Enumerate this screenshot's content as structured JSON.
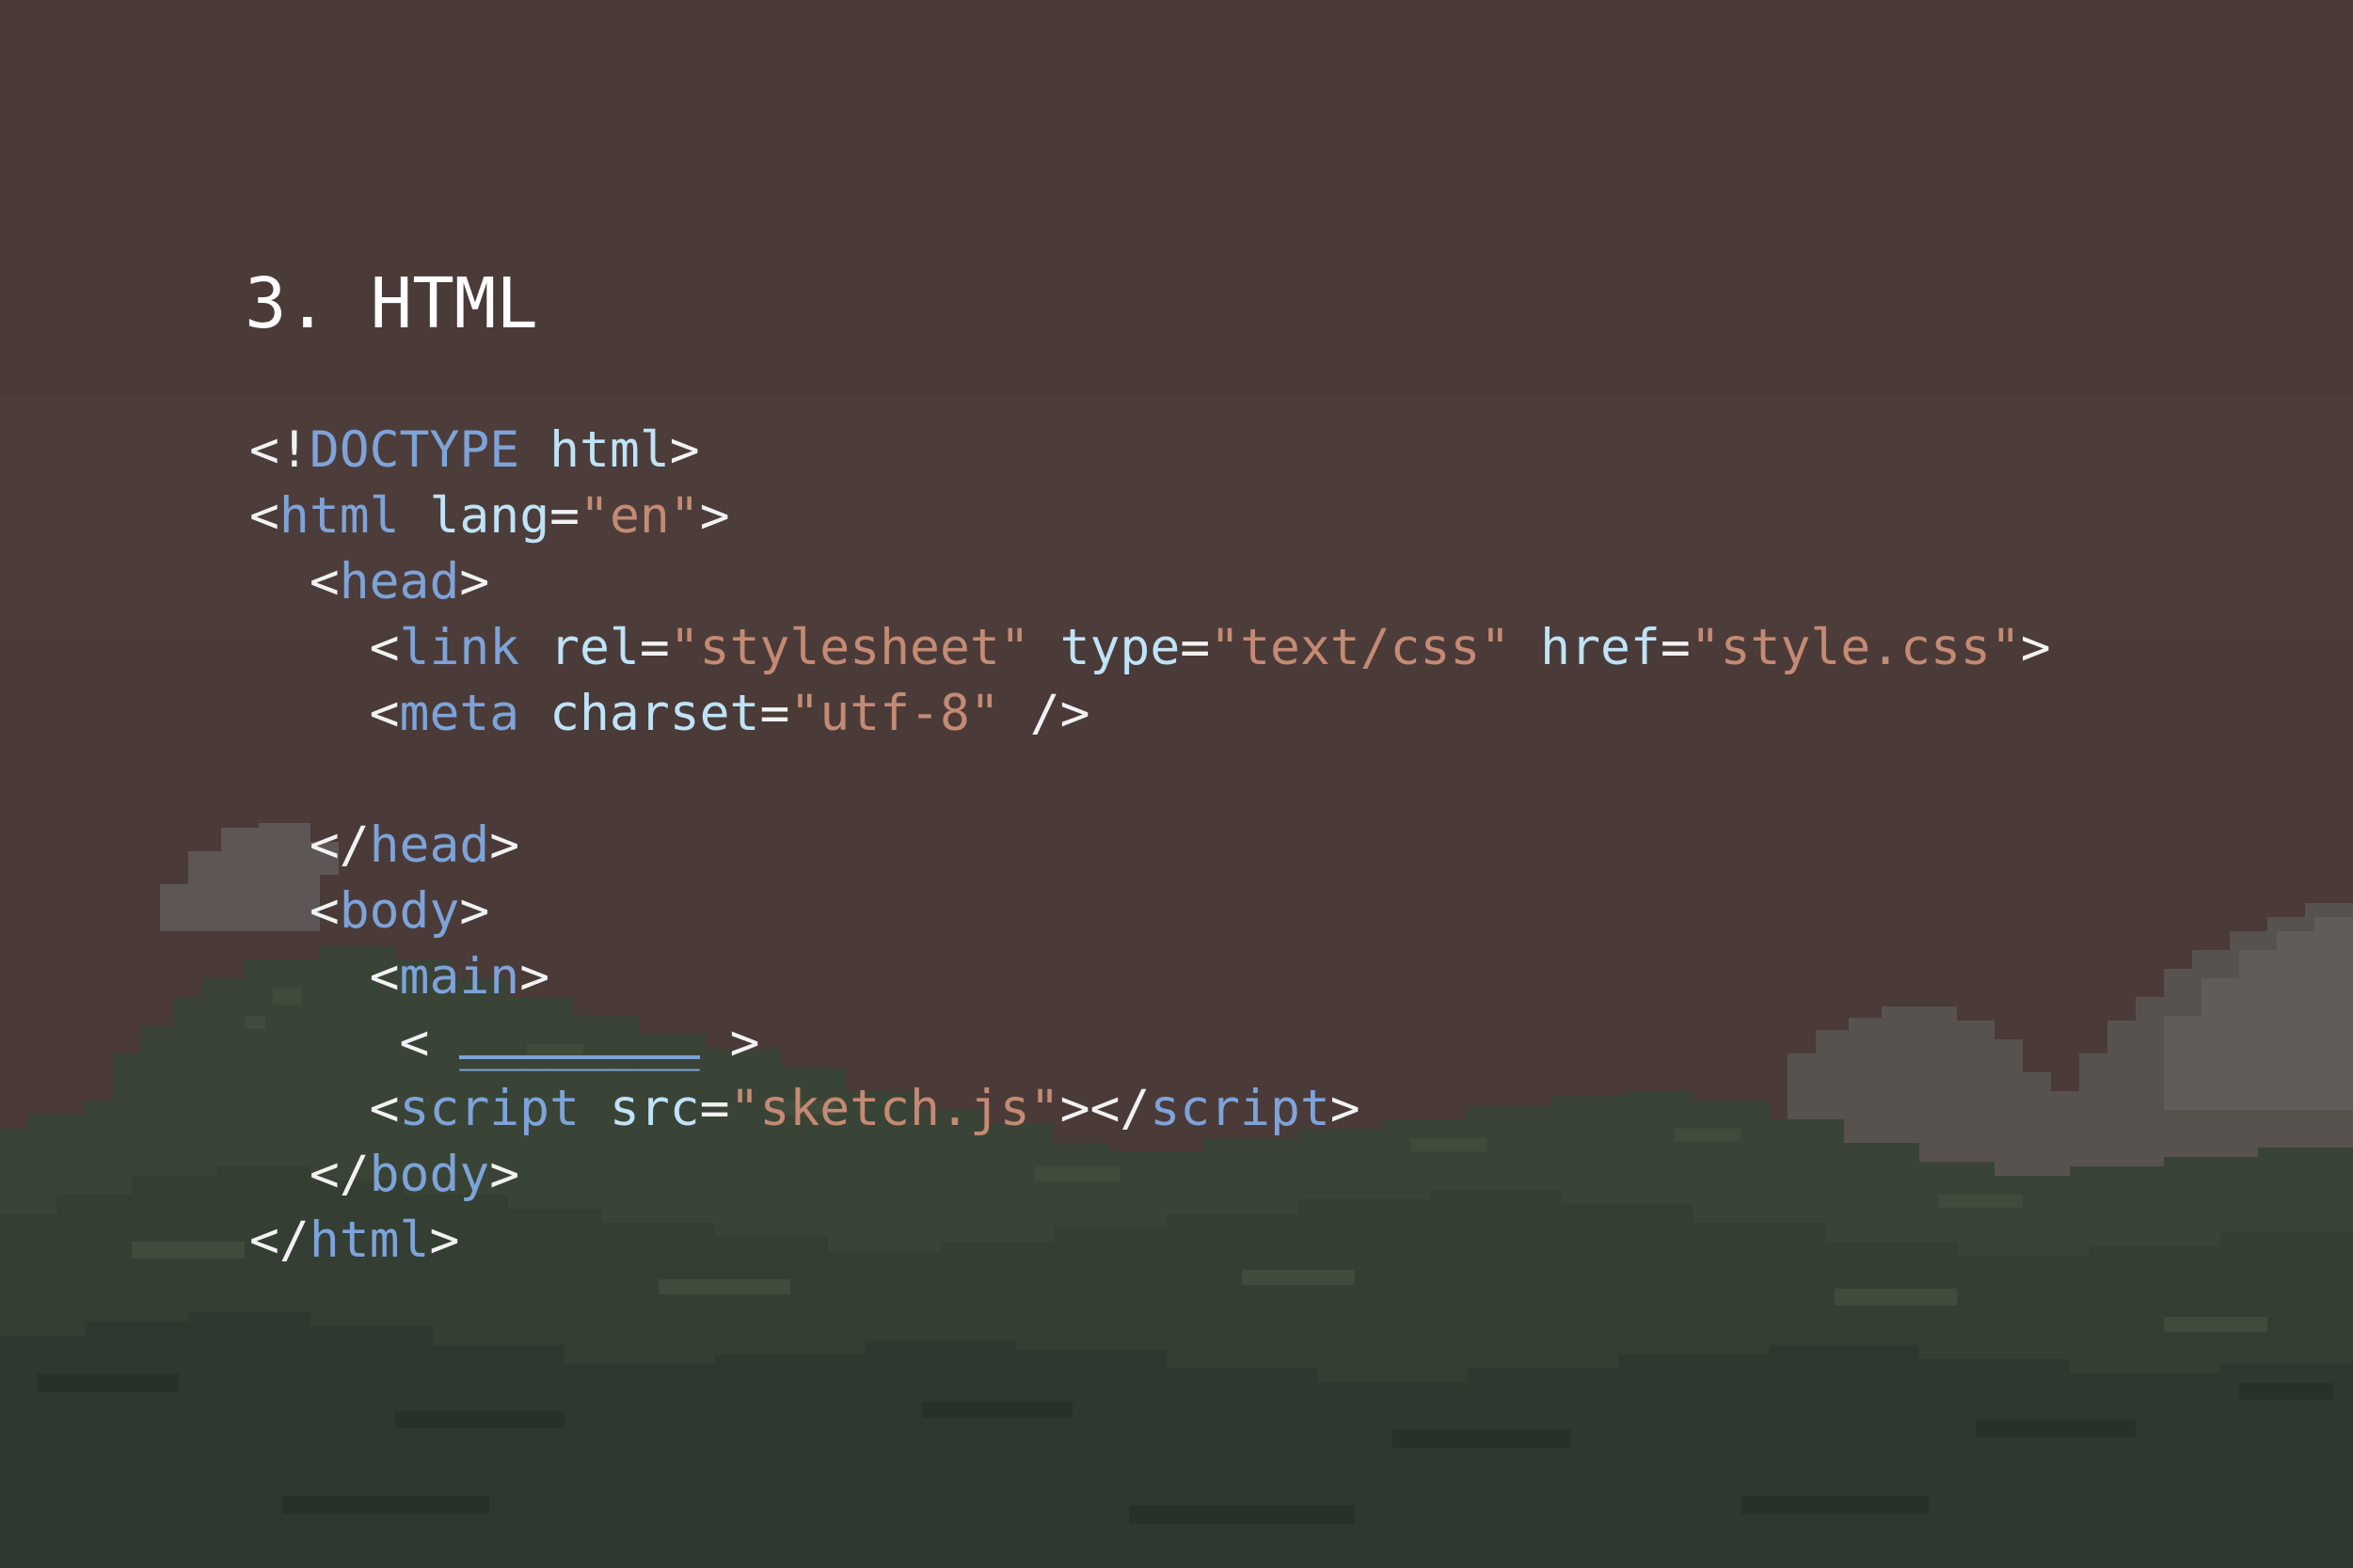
{
  "slide": {
    "title": "3. HTML"
  },
  "colors": {
    "sky": "#4a3b38",
    "hill_dark": "#2e382f",
    "hill_mid": "#3a4436",
    "hill_light": "#414b3c",
    "mountain_grey": "#58524f",
    "mountain_grey_light": "#5f5a58",
    "tag": "#7ea3d9",
    "attribute": "#bfe3f7",
    "string": "#c48a74",
    "punctuation": "#f2f2f2",
    "title": "#ffffff"
  },
  "code": {
    "lines": [
      [
        {
          "t": "<!",
          "k": "punct"
        },
        {
          "t": "DOCTYPE",
          "k": "tag"
        },
        {
          "t": " ",
          "k": "punct"
        },
        {
          "t": "html",
          "k": "attr"
        },
        {
          "t": ">",
          "k": "punct"
        }
      ],
      [
        {
          "t": "<",
          "k": "punct"
        },
        {
          "t": "html",
          "k": "tag"
        },
        {
          "t": " ",
          "k": "punct"
        },
        {
          "t": "lang",
          "k": "attr"
        },
        {
          "t": "=",
          "k": "punct"
        },
        {
          "t": "\"en\"",
          "k": "str"
        },
        {
          "t": ">",
          "k": "punct"
        }
      ],
      [
        {
          "t": "  <",
          "k": "punct"
        },
        {
          "t": "head",
          "k": "tag"
        },
        {
          "t": ">",
          "k": "punct"
        }
      ],
      [
        {
          "t": "    <",
          "k": "punct"
        },
        {
          "t": "link",
          "k": "tag"
        },
        {
          "t": " ",
          "k": "punct"
        },
        {
          "t": "rel",
          "k": "attr"
        },
        {
          "t": "=",
          "k": "punct"
        },
        {
          "t": "\"stylesheet\"",
          "k": "str"
        },
        {
          "t": " ",
          "k": "punct"
        },
        {
          "t": "type",
          "k": "attr"
        },
        {
          "t": "=",
          "k": "punct"
        },
        {
          "t": "\"text/css\"",
          "k": "str"
        },
        {
          "t": " ",
          "k": "punct"
        },
        {
          "t": "href",
          "k": "attr"
        },
        {
          "t": "=",
          "k": "punct"
        },
        {
          "t": "\"style.css\"",
          "k": "str"
        },
        {
          "t": ">",
          "k": "punct"
        }
      ],
      [
        {
          "t": "    <",
          "k": "punct"
        },
        {
          "t": "meta",
          "k": "tag"
        },
        {
          "t": " ",
          "k": "punct"
        },
        {
          "t": "charset",
          "k": "attr"
        },
        {
          "t": "=",
          "k": "punct"
        },
        {
          "t": "\"utf-8\"",
          "k": "str"
        },
        {
          "t": " />",
          "k": "punct"
        }
      ],
      [],
      [
        {
          "t": "  </",
          "k": "punct"
        },
        {
          "t": "head",
          "k": "tag"
        },
        {
          "t": ">",
          "k": "punct"
        }
      ],
      [
        {
          "t": "  <",
          "k": "punct"
        },
        {
          "t": "body",
          "k": "tag"
        },
        {
          "t": ">",
          "k": "punct"
        }
      ],
      [
        {
          "t": "    <",
          "k": "punct"
        },
        {
          "t": "main",
          "k": "tag"
        },
        {
          "t": ">",
          "k": "punct"
        }
      ],
      [
        {
          "t": "     < ",
          "k": "punct"
        },
        {
          "t": "________",
          "k": "blank"
        },
        {
          "t": " >",
          "k": "punct"
        }
      ],
      [
        {
          "t": "    <",
          "k": "punct"
        },
        {
          "t": "script",
          "k": "tag"
        },
        {
          "t": " ",
          "k": "punct"
        },
        {
          "t": "src",
          "k": "attr"
        },
        {
          "t": "=",
          "k": "punct"
        },
        {
          "t": "\"sketch.js\"",
          "k": "str"
        },
        {
          "t": "></",
          "k": "punct"
        },
        {
          "t": "script",
          "k": "tag"
        },
        {
          "t": ">",
          "k": "punct"
        }
      ],
      [
        {
          "t": "  </",
          "k": "punct"
        },
        {
          "t": "body",
          "k": "tag"
        },
        {
          "t": ">",
          "k": "punct"
        }
      ],
      [
        {
          "t": "</",
          "k": "punct"
        },
        {
          "t": "html",
          "k": "tag"
        },
        {
          "t": ">",
          "k": "punct"
        }
      ]
    ]
  }
}
